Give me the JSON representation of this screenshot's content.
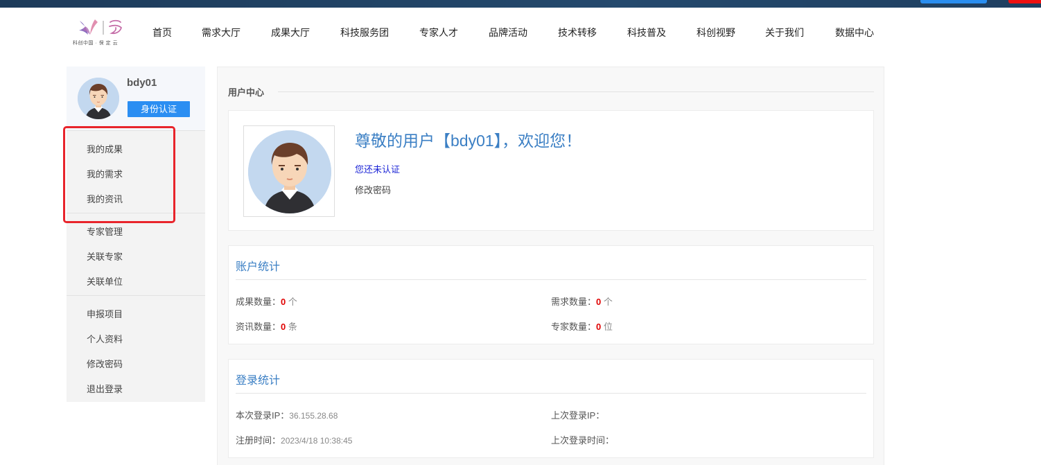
{
  "logo": {
    "caption": "科创中国 · 保 定 云",
    "icon": "kechuang-logo-icon"
  },
  "nav": [
    "首页",
    "需求大厅",
    "成果大厅",
    "科技服务团",
    "专家人才",
    "品牌活动",
    "技术转移",
    "科技普及",
    "科创视野",
    "关于我们",
    "数据中心"
  ],
  "sidebar": {
    "username": "bdy01",
    "verify_label": "身份认证",
    "group1": [
      "我的成果",
      "我的需求",
      "我的资讯"
    ],
    "group2": [
      "专家管理",
      "关联专家",
      "关联单位"
    ],
    "group3": [
      "申报项目",
      "个人资料",
      "修改密码",
      "退出登录"
    ]
  },
  "main": {
    "section_title": "用户中心",
    "welcome": "尊敬的用户【bdy01】，欢迎您！",
    "not_verified": "您还未认证",
    "change_password": "修改密码"
  },
  "account_stats": {
    "title": "账户统计",
    "achievements_label": "成果数量：",
    "achievements_value": "0",
    "achievements_unit": "个",
    "demands_label": "需求数量：",
    "demands_value": "0",
    "demands_unit": "个",
    "news_label": "资讯数量：",
    "news_value": "0",
    "news_unit": "条",
    "experts_label": "专家数量：",
    "experts_value": "0",
    "experts_unit": "位"
  },
  "login_stats": {
    "title": "登录统计",
    "current_ip_label": "本次登录IP：",
    "current_ip": "36.155.28.68",
    "last_ip_label": "上次登录IP：",
    "last_ip": "",
    "register_label": "注册时间：",
    "register_time": "2023/4/18 10:38:45",
    "last_login_label": "上次登录时间：",
    "last_login_time": ""
  },
  "colors": {
    "accent": "#2b8ef2",
    "title_blue": "#3b7fc4",
    "highlight_red": "#e8242b",
    "count_red": "#e00000"
  }
}
